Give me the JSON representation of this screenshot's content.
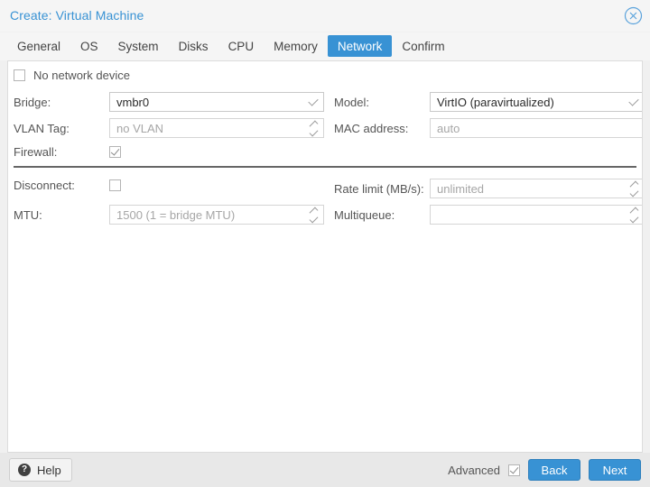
{
  "window": {
    "title": "Create: Virtual Machine",
    "close_icon": "close-circle-icon"
  },
  "tabs": [
    {
      "label": "General",
      "active": false
    },
    {
      "label": "OS",
      "active": false
    },
    {
      "label": "System",
      "active": false
    },
    {
      "label": "Disks",
      "active": false
    },
    {
      "label": "CPU",
      "active": false
    },
    {
      "label": "Memory",
      "active": false
    },
    {
      "label": "Network",
      "active": true
    },
    {
      "label": "Confirm",
      "active": false
    }
  ],
  "form": {
    "no_network_device": {
      "label": "No network device",
      "checked": false
    },
    "bridge": {
      "label": "Bridge:",
      "value": "vmbr0",
      "trigger": "chevron-down-icon"
    },
    "vlan_tag": {
      "label": "VLAN Tag:",
      "placeholder": "no VLAN",
      "trigger": "spinner-icon"
    },
    "firewall": {
      "label": "Firewall:",
      "checked": true
    },
    "model": {
      "label": "Model:",
      "value": "VirtIO (paravirtualized)",
      "trigger": "chevron-down-icon"
    },
    "mac_address": {
      "label": "MAC address:",
      "placeholder": "auto"
    },
    "disconnect": {
      "label": "Disconnect:",
      "checked": false
    },
    "mtu": {
      "label": "MTU:",
      "placeholder": "1500 (1 = bridge MTU)",
      "trigger": "spinner-icon"
    },
    "rate_limit": {
      "label": "Rate limit (MB/s):",
      "placeholder": "unlimited",
      "trigger": "spinner-icon"
    },
    "multiqueue": {
      "label": "Multiqueue:",
      "placeholder": "",
      "trigger": "spinner-icon"
    }
  },
  "footer": {
    "help_label": "Help",
    "help_icon": "question-mark-icon",
    "advanced_label": "Advanced",
    "advanced_checked": true,
    "back_label": "Back",
    "next_label": "Next"
  },
  "colors": {
    "accent": "#3892d4",
    "title_text": "#3892d4",
    "label_text": "#555555",
    "placeholder_text": "#a6a6a6",
    "panel_bg": "#ffffff",
    "chrome_bg": "#f5f5f5",
    "footer_bg": "#e8e8e8"
  }
}
